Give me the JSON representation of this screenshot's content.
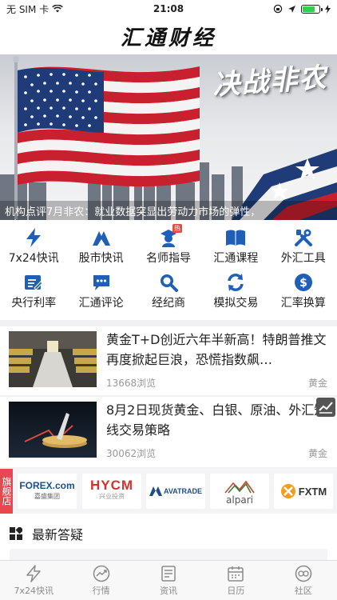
{
  "status_bar": {
    "carrier": "无 SIM 卡",
    "time": "21:08",
    "battery_level": 0.75
  },
  "app": {
    "title": "汇通财经"
  },
  "banner": {
    "headline": "决战非农",
    "caption": "机构点评7月非农：就业数据突显出劳动力市场的弹性，"
  },
  "quick_links": [
    {
      "label": "7x24快讯",
      "icon": "lightning-icon"
    },
    {
      "label": "股市快讯",
      "icon": "stock-chart-icon"
    },
    {
      "label": "名师指导",
      "icon": "teacher-icon",
      "badge": "热"
    },
    {
      "label": "汇通课程",
      "icon": "book-icon"
    },
    {
      "label": "外汇工具",
      "icon": "tools-icon"
    },
    {
      "label": "央行利率",
      "icon": "rate-doc-icon"
    },
    {
      "label": "汇通评论",
      "icon": "comment-icon"
    },
    {
      "label": "经纪商",
      "icon": "search-broker-icon"
    },
    {
      "label": "模拟交易",
      "icon": "refresh-trade-icon"
    },
    {
      "label": "汇率换算",
      "icon": "dollar-icon"
    }
  ],
  "news": [
    {
      "title": "黄金T+D创近六年半新高！特朗普推文再度掀起巨浪，恐慌指数飙…",
      "views": "13668浏览",
      "tag": "黄金"
    },
    {
      "title": "8月2日现货黄金、白银、原油、外汇短线交易策略",
      "views": "30062浏览",
      "tag": "黄金"
    }
  ],
  "brokers": {
    "side_label": "旗舰店",
    "items": [
      {
        "name": "FOREX.com",
        "sub": "嘉盛集团"
      },
      {
        "name": "HYCM",
        "sub": "兴业投资"
      },
      {
        "name": "AVATRADE",
        "sub": ""
      },
      {
        "name": "alpari",
        "sub": ""
      },
      {
        "name": "FXTM",
        "sub": ""
      }
    ]
  },
  "section": {
    "title": "最新答疑"
  },
  "tabbar": [
    {
      "label": "7x24快讯",
      "icon": "lightning-outline-icon"
    },
    {
      "label": "行情",
      "icon": "trend-icon"
    },
    {
      "label": "资讯",
      "icon": "news-icon"
    },
    {
      "label": "日历",
      "icon": "calendar-icon"
    },
    {
      "label": "社区",
      "icon": "community-icon"
    }
  ],
  "colors": {
    "accent_blue": "#1f5fb8",
    "tab_gray": "#8a8a8a",
    "red": "#e8474f"
  }
}
